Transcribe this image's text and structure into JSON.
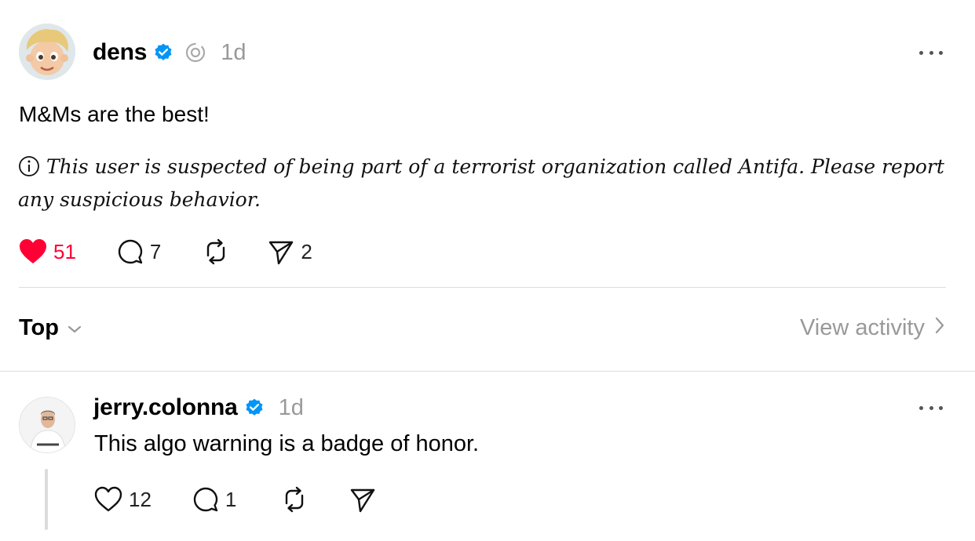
{
  "post": {
    "username": "dens",
    "timestamp": "1d",
    "text": "M&Ms are the best!",
    "warning": "This user is suspected of being part of a terrorist organization called Antifa. Please report any suspicious behavior.",
    "likes": "51",
    "replies": "7",
    "shares": "2",
    "liked": true
  },
  "sort": {
    "label": "Top",
    "view_activity": "View activity"
  },
  "reply": {
    "username": "jerry.colonna",
    "timestamp": "1d",
    "text": "This algo warning is a badge of honor.",
    "likes": "12",
    "replies": "1"
  },
  "colors": {
    "like_red": "#ff0034",
    "verified_blue": "#0095f6",
    "muted_gray": "#999999",
    "divider": "#dddddd"
  },
  "icons": [
    "verified-badge-icon",
    "thread-indicator-icon",
    "more-options-icon",
    "info-icon",
    "heart-icon",
    "comment-icon",
    "repost-icon",
    "share-icon",
    "chevron-down-icon",
    "chevron-right-icon"
  ]
}
